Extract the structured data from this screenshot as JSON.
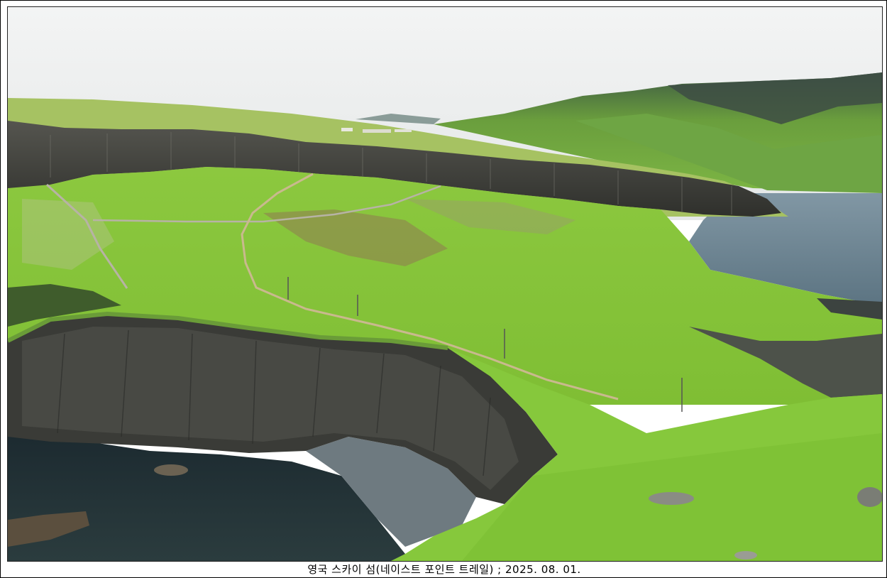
{
  "caption": "영국 스카이 섬(네이스트 포인트 트레일) ; 2025. 08. 01.",
  "photo": {
    "subject": "coastal-cliffs-landscape",
    "colors": {
      "sky": "#eef0f0",
      "grass": "#8fcf3c",
      "grass_dark": "#5c9a2a",
      "cliff": "#4a4b48",
      "sea": "#233036",
      "sea_far": "#6f8a99",
      "hill": "#6aa33c"
    }
  }
}
